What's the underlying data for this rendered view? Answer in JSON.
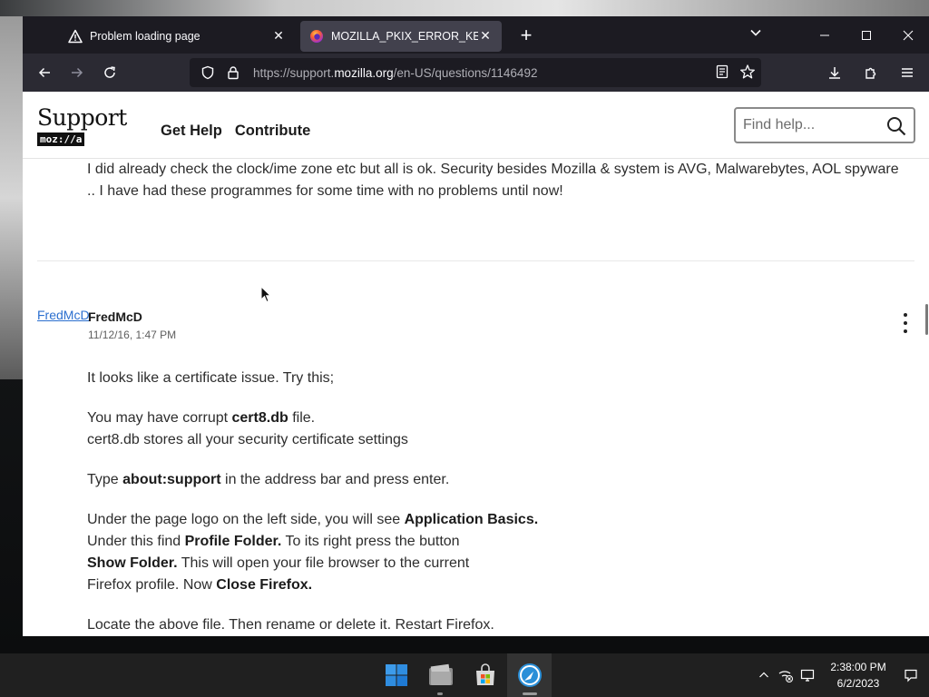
{
  "browser": {
    "tabs": [
      {
        "title": "Problem loading page",
        "icon": "warning-icon",
        "active": false
      },
      {
        "title": "MOZILLA_PKIX_ERROR_KEY_PINNING_FAILURE",
        "icon": "firefox-icon",
        "active": true
      }
    ],
    "url": {
      "prefix": "https://support.",
      "host": "mozilla.org",
      "path": "/en-US/questions/1146492"
    }
  },
  "site": {
    "logo_word": "Support",
    "logo_badge": "moz://a",
    "nav": [
      "Get Help",
      "Contribute"
    ],
    "search_placeholder": "Find help..."
  },
  "thread": {
    "previous_post_text": "I did already check the clock/ime zone etc but all is ok. Security besides Mozilla & system is AVG, Malwarebytes, AOL spyware .. I have had these programmes for some time with no problems until now!",
    "reply": {
      "avatar_alt": "FredMcD",
      "author": "FredMcD",
      "datetime": "11/12/16, 1:47 PM",
      "p1": "It looks like a certificate issue. Try this;",
      "p2_a": "You may have corrupt ",
      "p2_b": "cert8.db",
      "p2_c": " file.",
      "p2_line2": "cert8.db stores all your security certificate settings",
      "p3_a": "Type ",
      "p3_b": "about:support",
      "p3_c": " in the address bar and press enter.",
      "p4_l1a": "Under the page logo on the left side, you will see ",
      "p4_l1b": "Application Basics.",
      "p4_l2a": "Under this find ",
      "p4_l2b": "Profile Folder.",
      "p4_l2c": " To its right press the button",
      "p4_l3a": "Show Folder.",
      "p4_l3b": " This will open your file browser to the current",
      "p4_l4a": "Firefox profile. Now ",
      "p4_l4b": "Close Firefox.",
      "p5": "Locate the above file. Then rename or delete it. Restart Firefox."
    }
  },
  "taskbar": {
    "apps": [
      "start-icon",
      "file-explorer-icon",
      "microsoft-store-icon",
      "browser-app-icon"
    ],
    "time": "2:38:00 PM",
    "date": "6/2/2023"
  }
}
